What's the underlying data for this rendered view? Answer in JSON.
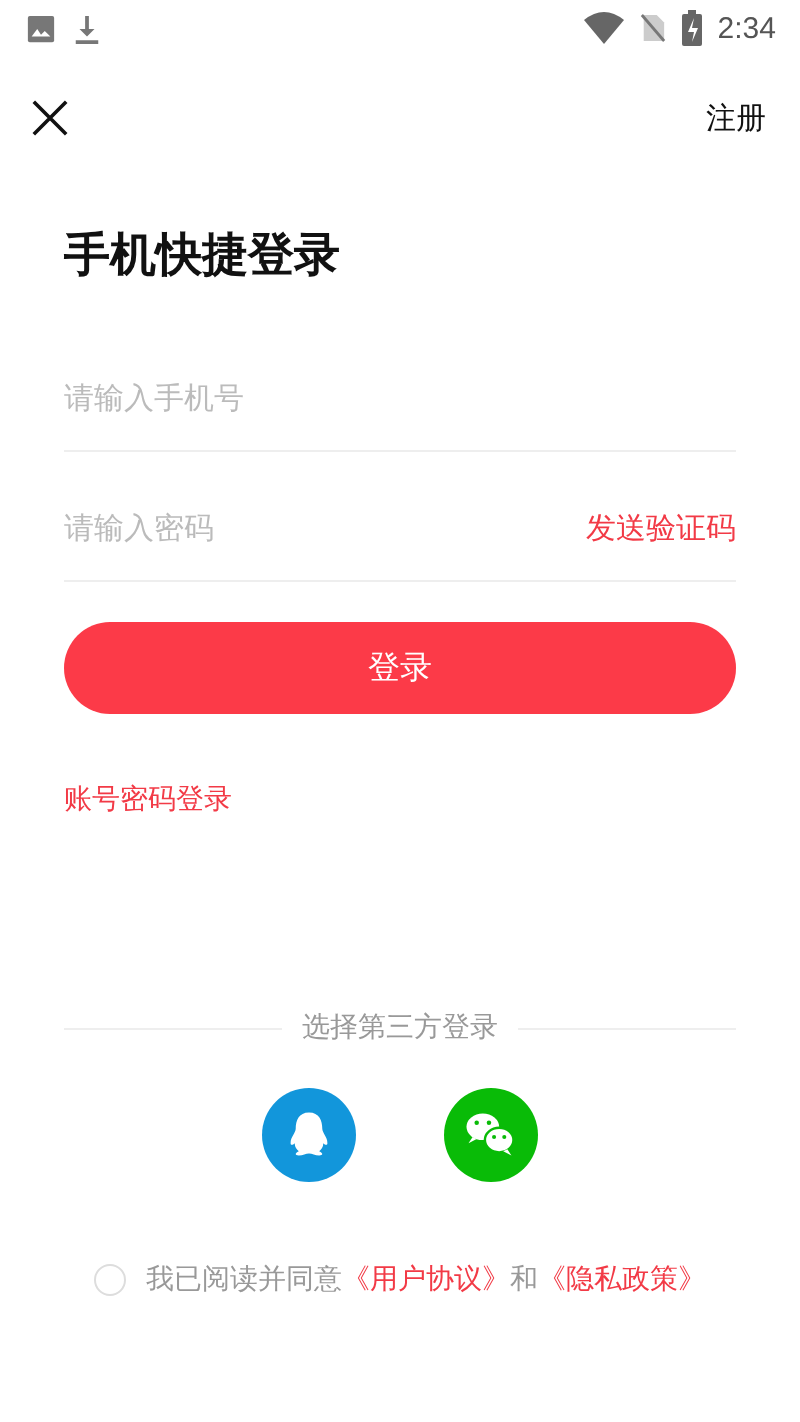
{
  "status_bar": {
    "time": "2:34"
  },
  "nav": {
    "action": "注册"
  },
  "title": "手机快捷登录",
  "fields": [
    {
      "placeholder": "请输入手机号"
    },
    {
      "placeholder": "请输入密码",
      "action": "发送验证码"
    }
  ],
  "login_button": "登录",
  "alt_login": "账号密码登录",
  "third_party": {
    "heading": "选择第三方登录",
    "providers": [
      {
        "kind": "qq"
      },
      {
        "kind": "wechat"
      }
    ]
  },
  "agreement": {
    "checked": false,
    "prefix": "我已阅读并同意",
    "link_1": "《用户协议》",
    "joiner": "和",
    "link_2": "《隐私政策》"
  }
}
